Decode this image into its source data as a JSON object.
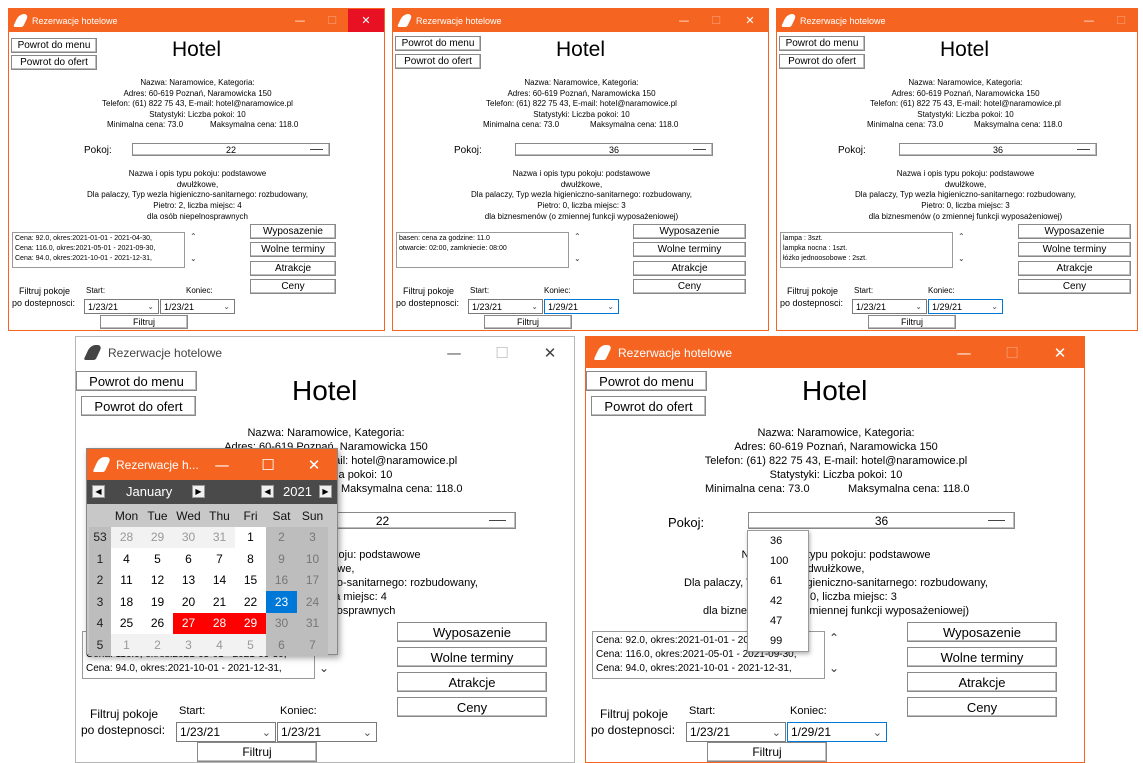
{
  "app_title": "Rezerwacje hotelowe",
  "buttons": {
    "menu": "Powrot do menu",
    "offers": "Powrot do ofert",
    "equip": "Wyposazenie",
    "free": "Wolne terminy",
    "attr": "Atrakcje",
    "prices": "Ceny",
    "filter": "Filtruj"
  },
  "heading": "Hotel",
  "hotel": {
    "line1": "Nazwa: Naramowice, Kategoria:",
    "line2": "Adres: 60-619 Poznań, Naramowicka 150",
    "line3": "Telefon: (61) 822 75 43, E-mail: hotel@naramowice.pl",
    "line4": "Statystyki: Liczba pokoi: 10",
    "min_price": "Minimalna cena: 73.0",
    "max_price": "Maksymalna cena: 118.0"
  },
  "room_label": "Pokoj:",
  "filter": {
    "label1": "Filtruj pokoje",
    "label2": "po dostepnosci:",
    "start_label": "Start:",
    "end_label": "Koniec:"
  },
  "rooms": {
    "r22": {
      "number": "22",
      "d1": "Nazwa i opis typu pokoju: podstawowe",
      "d2": "dwułżkowe,",
      "d3": "Dla palaczy,  Typ wezla higieniczno-sanitarnego: rozbudowany,",
      "d4": "Pietro: 2, liczba miejsc: 4",
      "d5": "dla osób niepelnosprawnych"
    },
    "r36": {
      "number": "36",
      "d1": "Nazwa i opis typu pokoju: podstawowe",
      "d2": "dwułżkowe,",
      "d3": "Dla palaczy,  Typ wezla higieniczno-sanitarnego: rozbudowany,",
      "d4": "Pietro: 0, liczba miejsc: 3",
      "d5": "dla biznesmenów (o zmiennej funkcji wyposażeniowej)"
    }
  },
  "lists": {
    "prices": [
      "Cena: 92.0, okres:2021-01-01 - 2021-04-30,",
      "Cena: 116.0, okres:2021-05-01 - 2021-09-30,",
      "Cena: 94.0, okres:2021-10-01 - 2021-12-31,"
    ],
    "attractions": [
      "basen: cena za godzine: 11.0",
      "otwarcie: 02:00, zamkniecie: 08:00"
    ],
    "equipment": [
      "lampa : 3szt.",
      "lampka nocna : 1szt.",
      "łóżko jednoosobowe : 2szt."
    ]
  },
  "dates": {
    "start": "1/23/21",
    "end1": "1/23/21",
    "end2": "1/29/21"
  },
  "calendar": {
    "title": "Rezerwacje h...",
    "month": "January",
    "year": "2021",
    "headers": [
      "Mon",
      "Tue",
      "Wed",
      "Thu",
      "Fri",
      "Sat",
      "Sun"
    ],
    "weeks": [
      {
        "wk": "53",
        "days": [
          "28",
          "29",
          "30",
          "31",
          "1",
          "2",
          "3"
        ]
      },
      {
        "wk": "1",
        "days": [
          "4",
          "5",
          "6",
          "7",
          "8",
          "9",
          "10"
        ]
      },
      {
        "wk": "2",
        "days": [
          "11",
          "12",
          "13",
          "14",
          "15",
          "16",
          "17"
        ]
      },
      {
        "wk": "3",
        "days": [
          "18",
          "19",
          "20",
          "21",
          "22",
          "23",
          "24"
        ]
      },
      {
        "wk": "4",
        "days": [
          "25",
          "26",
          "27",
          "28",
          "29",
          "30",
          "31"
        ]
      },
      {
        "wk": "5",
        "days": [
          "1",
          "2",
          "3",
          "4",
          "5",
          "6",
          "7"
        ]
      }
    ]
  },
  "dropdown_options": [
    "36",
    "100",
    "61",
    "42",
    "47",
    "99"
  ]
}
